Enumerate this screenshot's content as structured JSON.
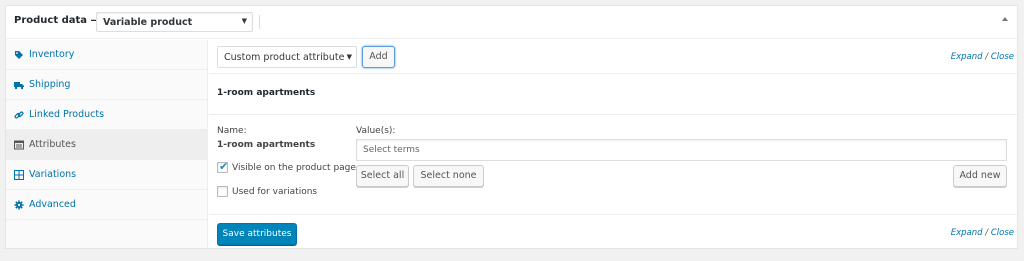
{
  "header": {
    "product_data_label": "Product data —",
    "product_type_selected": "Variable product"
  },
  "sidebar": {
    "items": [
      {
        "label": "Inventory",
        "icon": "tag-icon"
      },
      {
        "label": "Shipping",
        "icon": "truck-icon"
      },
      {
        "label": "Linked Products",
        "icon": "link-icon"
      },
      {
        "label": "Attributes",
        "icon": "list-icon",
        "active": true
      },
      {
        "label": "Variations",
        "icon": "grid-icon"
      },
      {
        "label": "Advanced",
        "icon": "gear-icon"
      }
    ]
  },
  "toolbar": {
    "attribute_select": "Custom product attribute",
    "add_label": "Add",
    "expand": "Expand",
    "separator": "/",
    "close": "Close"
  },
  "attribute": {
    "title": "1-room apartments",
    "name_label": "Name:",
    "name_value": "1-room apartments",
    "values_label": "Value(s):",
    "terms_placeholder": "Select terms",
    "visible_label": "Visible on the product page",
    "visible_checked": true,
    "variations_label": "Used for variations",
    "variations_checked": false,
    "select_all": "Select all",
    "select_none": "Select none",
    "add_new": "Add new"
  },
  "footer": {
    "save_label": "Save attributes",
    "expand": "Expand",
    "separator": "/",
    "close": "Close"
  },
  "colors": {
    "accent": "#0073aa",
    "primary_button": "#0085ba"
  }
}
